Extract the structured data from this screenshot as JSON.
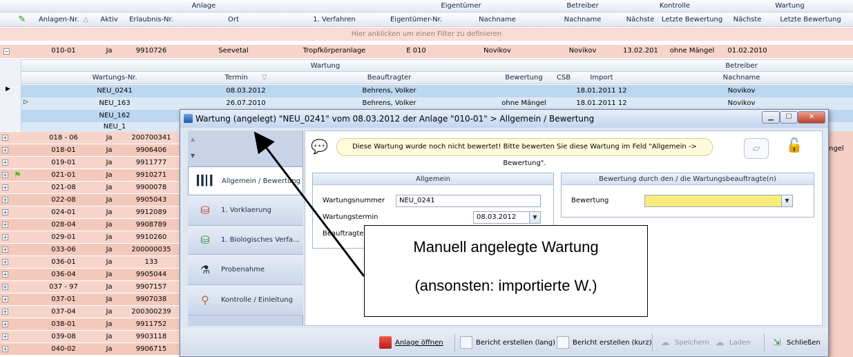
{
  "grid": {
    "group_headers": [
      "Anlage",
      "Eigentümer",
      "Betreiber",
      "Kontrolle",
      "Wartung"
    ],
    "columns": [
      "Anlagen-Nr.",
      "Aktiv",
      "Erlaubnis-Nr.",
      "Ort",
      "1. Verfahren",
      "Eigentümer-Nr.",
      "Nachname",
      "Nachname",
      "Nächste",
      "Letzte Bewertung",
      "Nächste",
      "Letzte Bewertung"
    ],
    "filter_row": "Hier anklicken um einen Filter zu definieren",
    "expanded_row": {
      "nr": "010-01",
      "aktiv": "Ja",
      "erlaubnis": "9910726",
      "ort": "Seevetal",
      "verfahren": "Tropfkörperanlage",
      "eig_nr": "E 010",
      "eig_name": "Novikov",
      "betr_name": "Novikov",
      "k_next": "13.02.201",
      "k_last": "ohne Mängel",
      "w_next": "01.02.2010"
    },
    "rows": [
      {
        "nr": "018 - 06",
        "aktiv": "Ja",
        "erlaubnis": "200700341"
      },
      {
        "nr": "018-01",
        "aktiv": "Ja",
        "erlaubnis": "9906406"
      },
      {
        "nr": "019-01",
        "aktiv": "Ja",
        "erlaubnis": "9911777"
      },
      {
        "nr": "021-01",
        "aktiv": "Ja",
        "erlaubnis": "9910271"
      },
      {
        "nr": "021-08",
        "aktiv": "Ja",
        "erlaubnis": "9900078"
      },
      {
        "nr": "022-08",
        "aktiv": "Ja",
        "erlaubnis": "9905043"
      },
      {
        "nr": "024-01",
        "aktiv": "Ja",
        "erlaubnis": "9912089"
      },
      {
        "nr": "028-04",
        "aktiv": "Ja",
        "erlaubnis": "9908789"
      },
      {
        "nr": "029-01",
        "aktiv": "Ja",
        "erlaubnis": "9910260"
      },
      {
        "nr": "033-06",
        "aktiv": "Ja",
        "erlaubnis": "200000035"
      },
      {
        "nr": "036-01",
        "aktiv": "Ja",
        "erlaubnis": "133"
      },
      {
        "nr": "036-04",
        "aktiv": "Ja",
        "erlaubnis": "9905044"
      },
      {
        "nr": "037 - 97",
        "aktiv": "Ja",
        "erlaubnis": "9907157"
      },
      {
        "nr": "037-01",
        "aktiv": "Ja",
        "erlaubnis": "9907038"
      },
      {
        "nr": "037-04",
        "aktiv": "Ja",
        "erlaubnis": "200300239"
      },
      {
        "nr": "038-01",
        "aktiv": "Ja",
        "erlaubnis": "9911752"
      },
      {
        "nr": "039-08",
        "aktiv": "Ja",
        "erlaubnis": "9903118"
      },
      {
        "nr": "040-02",
        "aktiv": "Ja",
        "erlaubnis": "9906715"
      }
    ],
    "right_fragment": "ngel"
  },
  "subgrid": {
    "group_headers": [
      "Wartung",
      "Betreiber"
    ],
    "columns": [
      "Wartungs-Nr.",
      "Termin",
      "Beauftragter",
      "Bewertung",
      "CSB",
      "Import",
      "Nachname"
    ],
    "rows": [
      {
        "nr": "NEU_0241",
        "termin": "08.03.2012",
        "beauftragter": "Behrens, Volker",
        "bewertung": "",
        "import": "18.01.2011 12",
        "name": "Novikov"
      },
      {
        "nr": "NEU_163",
        "termin": "26.07.2010",
        "beauftragter": "Behrens, Volker",
        "bewertung": "ohne Mängel",
        "import": "18.01.2011 12",
        "name": "Novikov"
      },
      {
        "nr": "NEU_162",
        "termin": "",
        "beauftragter": "",
        "bewertung": "",
        "import": "",
        "name": ""
      },
      {
        "nr": "NEU_1",
        "termin": "",
        "beauftragter": "",
        "bewertung": "",
        "import": "",
        "name": ""
      }
    ]
  },
  "dialog": {
    "title": "Wartung (angelegt) \"NEU_0241\" vom 08.03.2012 der Anlage \"010-01\" > Allgemein / Bewertung",
    "nav": [
      "Allgemein / Bewertung",
      "1. Vorklaerung",
      "1. Biologisches Verfa...",
      "Probenahme",
      "Kontrolle / Einleitung"
    ],
    "message": "Diese Wartung wurde noch nicht bewertet! Bitte bewerten Sie diese Wartung im Feld \"Allgemein -> Bewertung\".",
    "group_allgemein": "Allgemein",
    "label_nummer": "Wartungsnummer",
    "value_nummer": "NEU_0241",
    "label_termin": "Wartungstermin",
    "value_termin": "08.03.2012",
    "label_beauftragter": "Beauftragter",
    "group_bewertung": "Bewertung durch den / die Wartungsbeauftragte(n)",
    "label_bewertung": "Bewertung",
    "value_bewertung": "",
    "footer": {
      "anlage": "Anlage öffnen",
      "lang": "Bericht erstellen (lang)",
      "kurz": "Bericht erstellen (kurz)",
      "speichern": "Speichern",
      "laden": "Laden",
      "schliessen": "Schließen"
    }
  },
  "callout": {
    "line1": "Manuell angelegte Wartung",
    "line2": "(ansonsten: importierte W.)"
  },
  "colors": {
    "row_pink": "#f7d4c9",
    "row_blue": "#bcd7f0",
    "highlight_yellow": "#f7ec7a",
    "accent_red": "#d92b2b"
  }
}
